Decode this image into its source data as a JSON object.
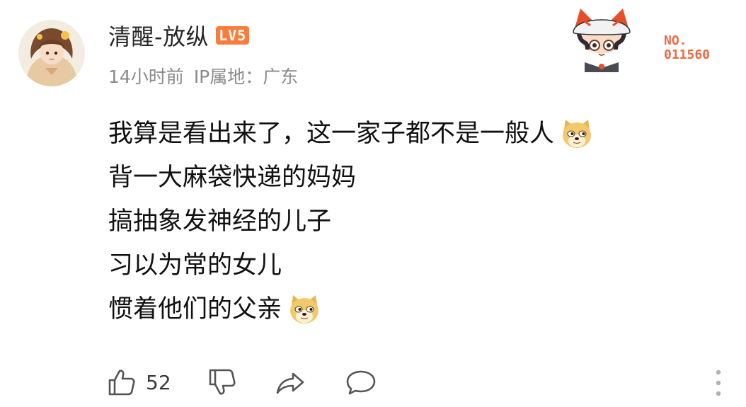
{
  "comment": {
    "username": "清醒-放纵",
    "level": "LV5",
    "time": "14小时前",
    "ip_location": "IP属地：广东",
    "pendant_number": [
      "NO.",
      "011560"
    ],
    "lines": [
      "我算是看出来了，这一家子都不是一般人",
      "背一大麻袋快递的妈妈",
      "搞抽象发神经的儿子",
      "习以为常的女儿",
      "惯着他们的父亲"
    ],
    "like_count": "52"
  },
  "icons": {
    "avatar": "user-avatar",
    "mascot": "fan-pendant-mascot",
    "doge": "doge-emoji",
    "like": "thumbs-up-icon",
    "dislike": "thumbs-down-icon",
    "share": "share-arrow-icon",
    "reply": "speech-bubble-icon",
    "more": "vertical-dots-icon"
  },
  "colors": {
    "level_badge": "#fb7b3a",
    "pendant_number": "#ec6a43",
    "meta_text": "#8a8a8a",
    "icon_stroke": "#555555"
  }
}
